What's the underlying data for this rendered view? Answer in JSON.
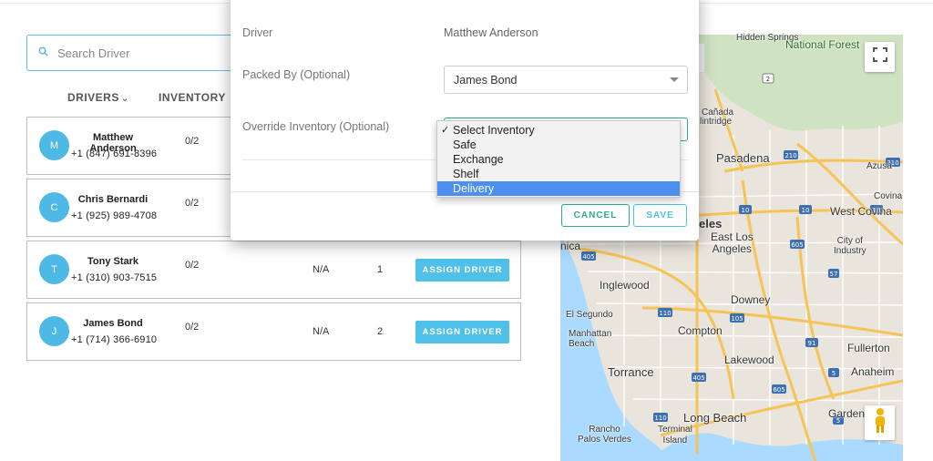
{
  "search": {
    "placeholder": "Search Driver"
  },
  "columns": {
    "drivers": "DRIVERS",
    "inventory": "INVENTORY"
  },
  "drivers": [
    {
      "initial": "M",
      "name": "Matthew Anderson",
      "phone": "+1 (847) 691-8396",
      "count": "0/2",
      "na": "",
      "num": "",
      "button": ""
    },
    {
      "initial": "C",
      "name": "Chris Bernardi",
      "phone": "+1 (925) 989-4708",
      "count": "0/2",
      "na": "",
      "num": "",
      "button": ""
    },
    {
      "initial": "T",
      "name": "Tony Stark",
      "phone": "+1 (310) 903-7515",
      "count": "0/2",
      "na": "N/A",
      "num": "1",
      "button": "ASSIGN DRIVER"
    },
    {
      "initial": "J",
      "name": "James Bond",
      "phone": "+1 (714) 366-6910",
      "count": "0/2",
      "na": "N/A",
      "num": "2",
      "button": "ASSIGN DRIVER"
    }
  ],
  "modal": {
    "driver_label": "Driver",
    "driver_value": "Matthew Anderson",
    "packed_label": "Packed By (Optional)",
    "packed_value": "James Bond",
    "override_label": "Override Inventory (Optional)",
    "cancel": "CANCEL",
    "save": "SAVE"
  },
  "inventory_options": {
    "items": [
      "Select Inventory",
      "Safe",
      "Exchange",
      "Shelf",
      "Delivery"
    ],
    "checked": "Select Inventory",
    "highlighted": "Delivery"
  },
  "map": {
    "labels": {
      "hidden_springs": "Hidden\nSprings",
      "national_forest": "National Forest",
      "canada": "Cañada",
      "flintridge": "lintridge",
      "pasadena": "Pasadena",
      "azusa": "Azusa",
      "covina": "Covina",
      "west_covina": "West Covina",
      "angeles": "eles",
      "east_los_angeles": "East Los\nAngeles",
      "city_of_industry": "City of\nIndustry",
      "santa_monica": "nica",
      "inglewood": "Inglewood",
      "downey": "Downey",
      "el_segundo": "El Segundo",
      "compton": "Compton",
      "manhattan_beach": "Manhattan\nBeach",
      "fullerton": "Fullerton",
      "lakewood": "Lakewood",
      "torrance": "Torrance",
      "anaheim": "Anaheim",
      "rancho_palos_verdes": "Rancho\nPalos Verdes",
      "long_beach": "Long Beach",
      "terminal_island": "Terminal\nIsland",
      "garden": "Garden"
    },
    "shields": [
      "2",
      "210",
      "210",
      "10",
      "10",
      "10",
      "605",
      "405",
      "110",
      "105",
      "91",
      "405",
      "605",
      "110",
      "5",
      "5",
      "57"
    ],
    "colors": {
      "land": "#e9e5dc",
      "forest": "#cfe3c3",
      "water": "#aadaff",
      "highway": "#f5c356",
      "road": "#ffffff"
    }
  },
  "icons": {
    "search": "search-icon",
    "fullscreen": "fullscreen-icon",
    "pegman": "street-view-pegman-icon"
  },
  "colors": {
    "accent": "#4fc1e9",
    "avatar": "#4fb9e6",
    "cancel_border": "#2cae88",
    "highlight": "#4c8ff0"
  }
}
